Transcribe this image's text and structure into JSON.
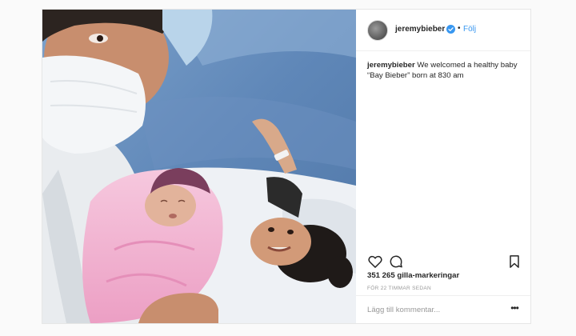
{
  "post": {
    "photo": {
      "alt": ""
    },
    "header": {
      "username": "jeremybieber",
      "verified_icon": "verified-badge-icon",
      "separator": "•",
      "follow_label": "Följ"
    },
    "caption": {
      "username": "jeremybieber",
      "text": "We welcomed a healthy baby “Bay Bieber” born at 830 am"
    },
    "actions": {
      "like_icon": "heart-icon",
      "comment_icon": "comment-bubble-icon",
      "save_icon": "bookmark-icon"
    },
    "likes": "351 265 gilla-markeringar",
    "timestamp": "FÖR 22 TIMMAR SEDAN",
    "comment": {
      "placeholder": "Lägg till kommentar...",
      "more_label": "•••"
    }
  },
  "colors": {
    "link": "#3897f0",
    "verified": "#3897f0",
    "muted": "#999999",
    "text": "#262626",
    "border": "#efefef"
  }
}
